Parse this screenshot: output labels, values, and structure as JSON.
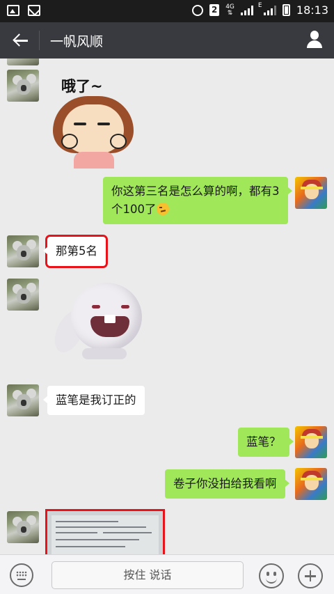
{
  "status_bar": {
    "sim_slot": "2",
    "network_type": "4G",
    "network_sub": "E",
    "time": "18:13"
  },
  "header": {
    "title": "一帆风顺"
  },
  "messages": {
    "sticker_1_caption": "哦了~",
    "msg_1": "你这第三名是怎么算的啊，都有3个100了",
    "msg_2": "那第5名",
    "msg_3": "蓝笔是我订正的",
    "msg_4": "蓝笔？",
    "msg_5": "卷子你没拍给我看啊"
  },
  "input_bar": {
    "hold_to_talk": "按住 说话"
  },
  "colors": {
    "header_bg": "#393a3f",
    "sent_bubble": "#a0e75a",
    "received_bubble": "#ffffff",
    "highlight_box": "#e8131a"
  }
}
